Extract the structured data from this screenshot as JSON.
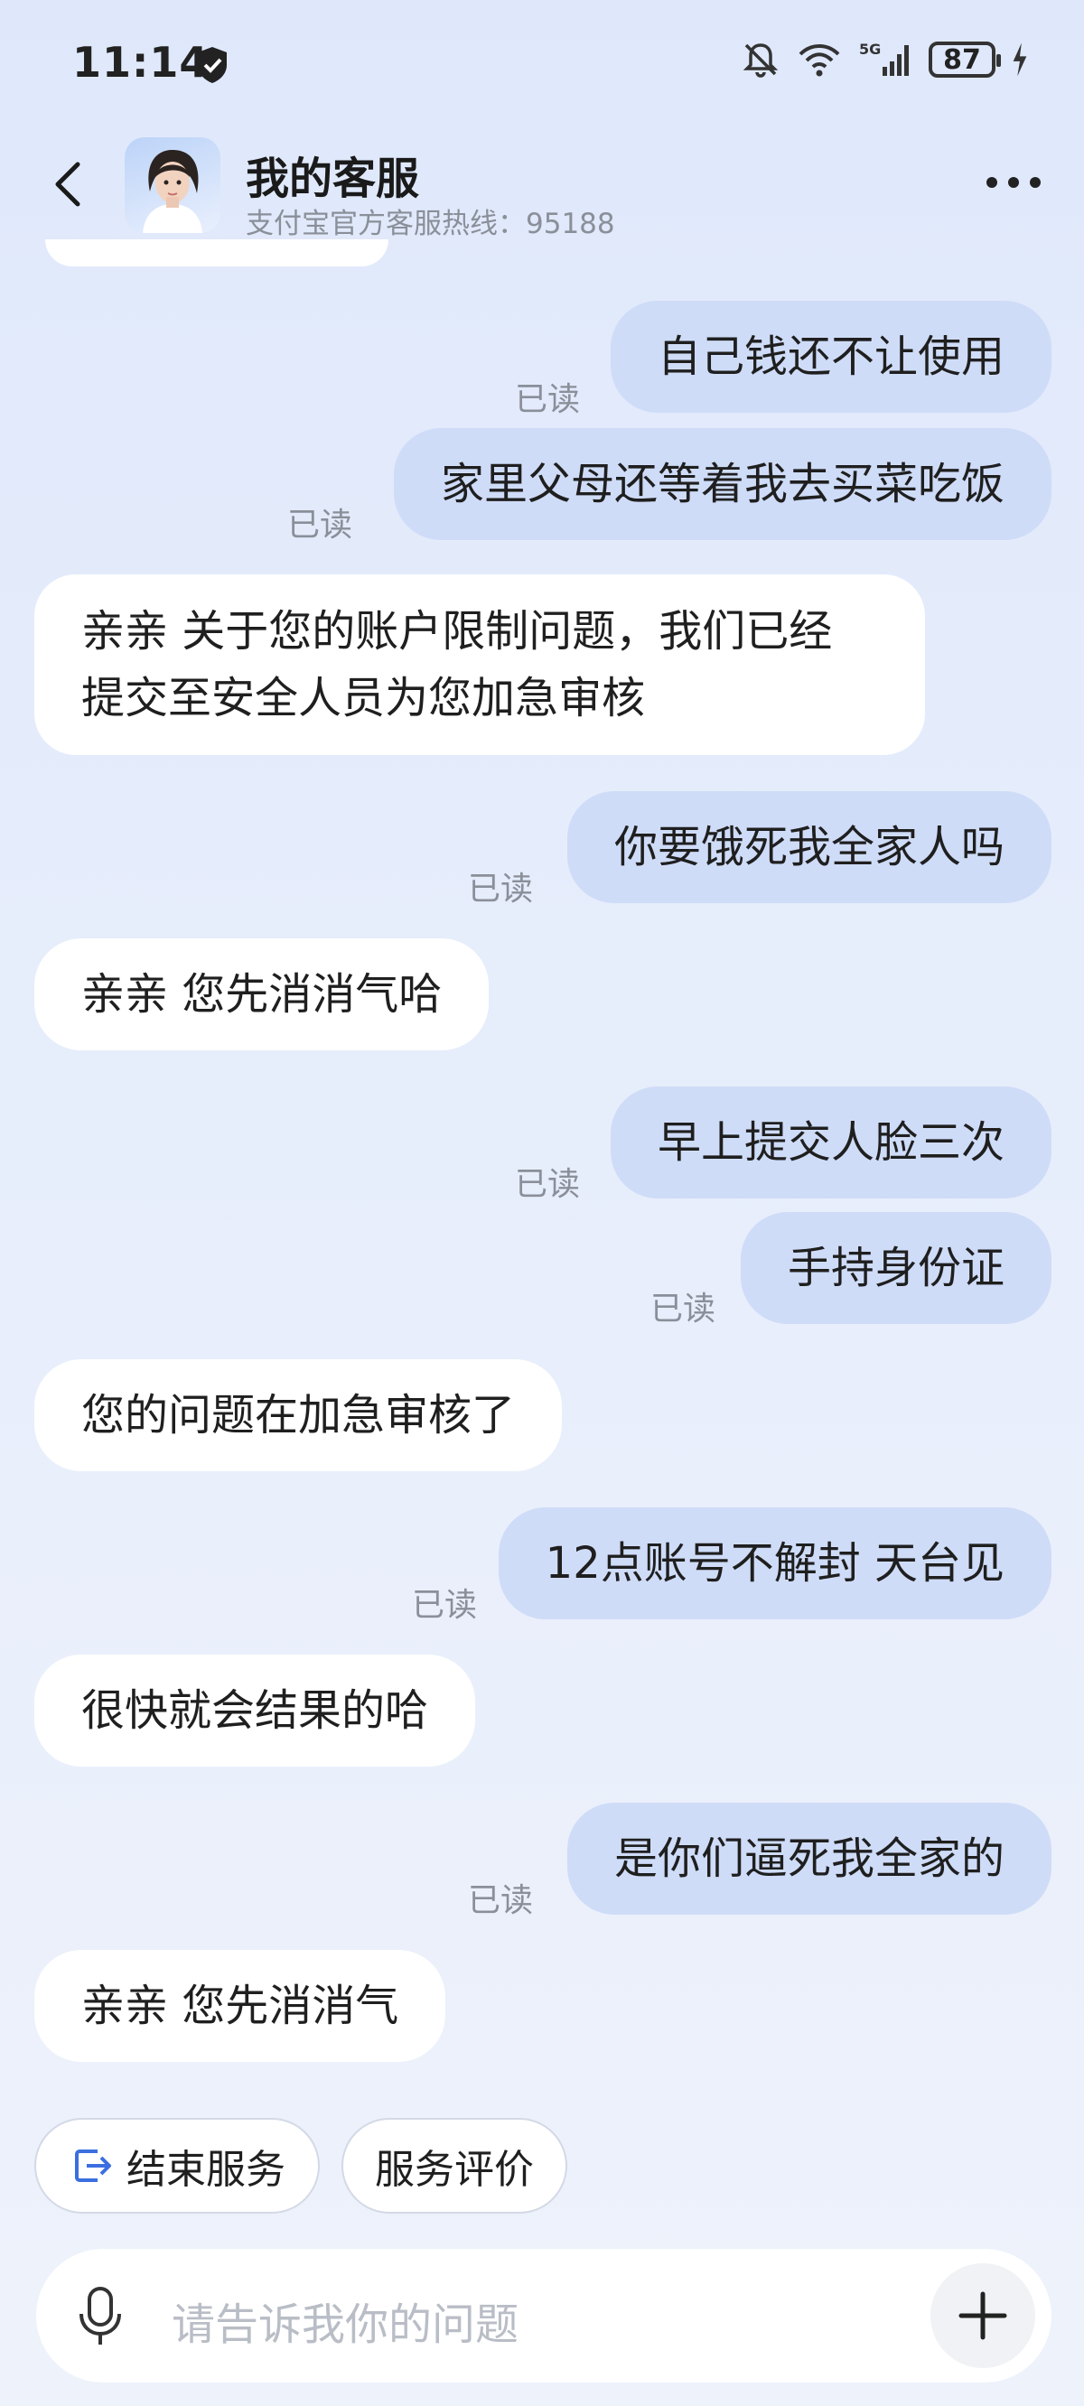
{
  "status_bar": {
    "time": "11:14",
    "battery": "87",
    "icons": [
      "shield-icon",
      "mute-bell-icon",
      "wifi-icon",
      "signal-5g-icon",
      "battery-icon",
      "charging-icon"
    ]
  },
  "header": {
    "back_icon": "chevron-left-icon",
    "title": "我的客服",
    "subtitle": "支付宝官方客服热线：95188",
    "more_icon": "more-dots-icon"
  },
  "messages": [
    {
      "side": "out",
      "text": "自己钱还不让使用",
      "status": "已读"
    },
    {
      "side": "out",
      "text": "家里父母还等着我去买菜吃饭",
      "status": "已读"
    },
    {
      "side": "in",
      "lines": [
        "亲亲 关于您的账户限制问题，我们已经",
        "提交至安全人员为您加急审核"
      ]
    },
    {
      "side": "out",
      "text": "你要饿死我全家人吗",
      "status": "已读"
    },
    {
      "side": "in",
      "text": "亲亲 您先消消气哈"
    },
    {
      "side": "out",
      "text": "早上提交人脸三次",
      "status": "已读"
    },
    {
      "side": "out",
      "text": "手持身份证",
      "status": "已读"
    },
    {
      "side": "in",
      "text": "您的问题在加急审核了"
    },
    {
      "side": "out",
      "text": "12点账号不解封 天台见",
      "status": "已读"
    },
    {
      "side": "in",
      "text": "很快就会结果的哈"
    },
    {
      "side": "out",
      "text": "是你们逼死我全家的",
      "status": "已读"
    },
    {
      "side": "in",
      "text": "亲亲 您先消消气"
    }
  ],
  "quick_actions": {
    "end_service": "结束服务",
    "rate_service": "服务评价"
  },
  "input": {
    "placeholder": "请告诉我你的问题",
    "mic_icon": "microphone-icon",
    "plus_icon": "plus-icon"
  },
  "colors": {
    "outgoing_bubble": "#cfdcf8",
    "incoming_bubble": "#ffffff",
    "accent": "#3b6fe0",
    "read_text": "#8a8f99"
  }
}
